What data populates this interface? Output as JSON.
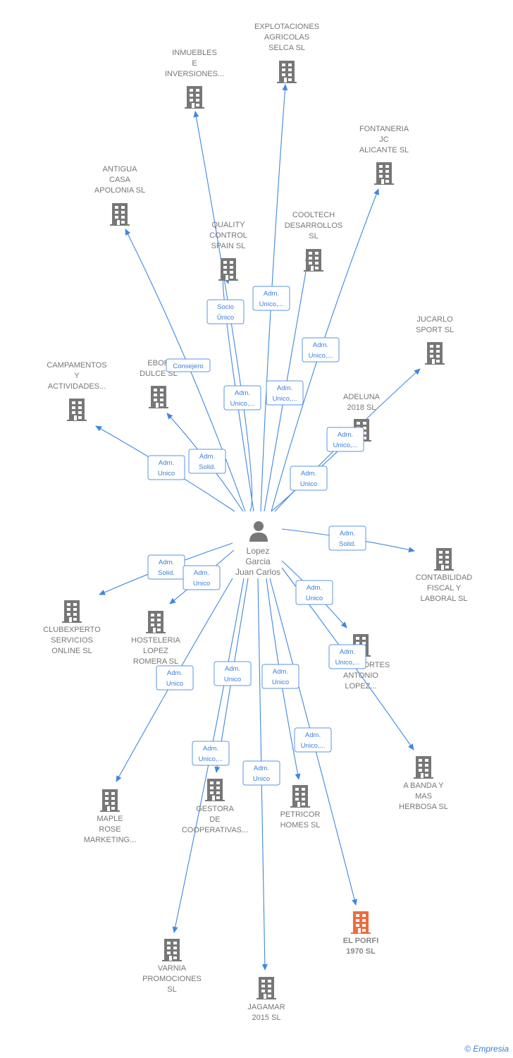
{
  "center": {
    "name_lines": [
      "Lopez",
      "Garcia",
      "Juan Carlos"
    ],
    "icon": "person-icon"
  },
  "nodes": [
    {
      "lines": [
        "EXPLOTACIONES",
        "AGRICOLAS",
        "SELCA  SL"
      ]
    },
    {
      "lines": [
        "INMUEBLES",
        "E",
        "INVERSIONES..."
      ]
    },
    {
      "lines": [
        "FONTANERIA",
        "JC",
        "ALICANTE  SL"
      ]
    },
    {
      "lines": [
        "ANTIGUA",
        "CASA",
        "APOLONIA SL"
      ]
    },
    {
      "lines": [
        "QUALITY",
        "CONTROL",
        "SPAIN  SL"
      ]
    },
    {
      "lines": [
        "COOLTECH",
        "DESARROLLOS",
        "SL"
      ]
    },
    {
      "lines": [
        "JUCARLO",
        "SPORT  SL"
      ]
    },
    {
      "lines": [
        "CAMPAMENTOS",
        "Y",
        "ACTIVIDADES..."
      ]
    },
    {
      "lines": [
        "EBOR",
        "DULCE  SL"
      ]
    },
    {
      "lines": [
        "ADELUNA",
        "2018  SL"
      ]
    },
    {
      "lines": [
        "CONTABILIDAD",
        "FISCAL Y",
        "LABORAL  SL"
      ]
    },
    {
      "lines": [
        "CLUBEXPERTO",
        "SERVICIOS",
        "ONLINE SL"
      ]
    },
    {
      "lines": [
        "HOSTELERIA",
        "LOPEZ",
        "ROMERA  SL"
      ]
    },
    {
      "lines": [
        "TRANSPORTES",
        "ANTONIO",
        "LOPEZ..."
      ]
    },
    {
      "lines": [
        "A BANDA Y",
        "MAS",
        "HERBOSA  SL"
      ]
    },
    {
      "lines": [
        "MAPLE",
        "ROSE",
        "MARKETING..."
      ]
    },
    {
      "lines": [
        "GESTORA",
        "DE",
        "COOPERATIVAS..."
      ]
    },
    {
      "lines": [
        "PETRICOR",
        "HOMES  SL"
      ]
    },
    {
      "lines": [
        "EL PORFI",
        "1970  SL"
      ],
      "highlight": true
    },
    {
      "lines": [
        "VARNIA",
        "PROMOCIONES",
        "SL"
      ]
    },
    {
      "lines": [
        "JAGAMAR",
        "2015  SL"
      ]
    }
  ],
  "edges": [
    {
      "target": 0,
      "label": [
        "Adm.",
        "Unico,..."
      ]
    },
    {
      "target": 1,
      "label": [
        "Adm.",
        "Unico,..."
      ]
    },
    {
      "target": 2,
      "label": [
        "Adm.",
        "Unico,..."
      ]
    },
    {
      "target": 3,
      "label": [
        "Consejero"
      ]
    },
    {
      "target": 4,
      "label": [
        "Socio",
        "Único"
      ]
    },
    {
      "target": 5,
      "label": [
        "Adm.",
        "Unico,..."
      ]
    },
    {
      "target": 6,
      "label": [
        "Adm.",
        "Unico,..."
      ]
    },
    {
      "target": 7,
      "label": [
        "Adm.",
        "Unico"
      ]
    },
    {
      "target": 8,
      "label": [
        "Adm.",
        "Solid."
      ]
    },
    {
      "target": 9,
      "label": [
        "Adm.",
        "Unico"
      ]
    },
    {
      "target": 10,
      "label": [
        "Adm.",
        "Solid."
      ]
    },
    {
      "target": 11,
      "label": [
        "Adm.",
        "Solid."
      ]
    },
    {
      "target": 12,
      "label": [
        "Adm.",
        "Unico"
      ]
    },
    {
      "target": 13,
      "label": [
        "Adm.",
        "Unico"
      ]
    },
    {
      "target": 14,
      "label": [
        "Adm.",
        "Unico,..."
      ]
    },
    {
      "target": 15,
      "label": [
        "Adm.",
        "Unico"
      ]
    },
    {
      "target": 16,
      "label": [
        "Adm.",
        "Unico"
      ]
    },
    {
      "target": 17,
      "label": [
        "Adm.",
        "Unico"
      ]
    },
    {
      "target": 18,
      "label": [
        "Adm.",
        "Unico,..."
      ]
    },
    {
      "target": 19,
      "label": [
        "Adm.",
        "Unico,..."
      ]
    },
    {
      "target": 20,
      "label": [
        "Adm.",
        "Unico"
      ]
    }
  ],
  "colors": {
    "edge": "#3f87e2",
    "building": "#777777",
    "highlight": "#f26a3d",
    "label_text": "#3a7fd8"
  },
  "footer": {
    "copyright": "©",
    "brand": "Empresia"
  }
}
